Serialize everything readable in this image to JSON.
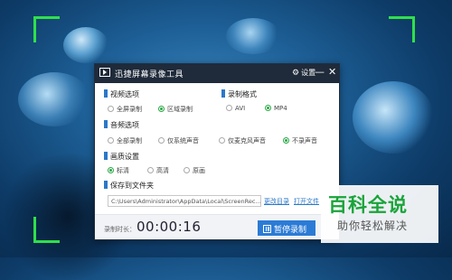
{
  "window": {
    "title": "迅捷屏幕录像工具",
    "settings_label": "设置",
    "minimize_glyph": "—",
    "close_glyph": "✕"
  },
  "video": {
    "label": "视频选项",
    "options": [
      "全屏录制",
      "区域录制"
    ],
    "selected": "区域录制"
  },
  "format": {
    "label": "录制格式",
    "options": [
      "AVI",
      "MP4"
    ],
    "selected": "MP4"
  },
  "audio": {
    "label": "音频选项",
    "options": [
      "全部录制",
      "仅系统声音",
      "仅麦克风声音",
      "不录声音"
    ],
    "selected": "不录声音"
  },
  "quality": {
    "label": "画质设置",
    "options": [
      "标清",
      "高清",
      "原画"
    ],
    "selected": "标清"
  },
  "save": {
    "label": "保存到文件夹",
    "path": "C:\\Users\\Administrator\\AppData\\Local\\ScreenRec...",
    "change_link": "更改目录",
    "open_link": "打开文件"
  },
  "footer": {
    "duration_label": "录制时长：",
    "timer": "00:00:16",
    "pause_button": "暂停录制"
  },
  "watermark": {
    "logo": "百科全说",
    "subtitle": "助你轻松解决"
  },
  "colors": {
    "accent": "#2b78c8",
    "radio_selected": "#2aa845",
    "corner_marks": "#2fe04a",
    "titlebar": "#1f2a3a"
  }
}
